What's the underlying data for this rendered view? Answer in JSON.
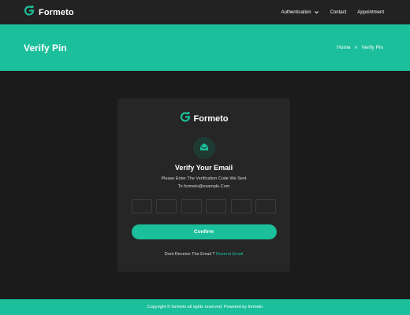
{
  "colors": {
    "accent": "#1bbf9b",
    "navbar_bg": "#222222",
    "page_bg": "#1b1b1b",
    "card_bg": "#262626"
  },
  "navbar": {
    "brand": "Formeto",
    "brand_icon": "formeto-logo-icon",
    "links": [
      {
        "label": "Authentication",
        "has_dropdown": true
      },
      {
        "label": "Contact"
      },
      {
        "label": "Appointment"
      }
    ]
  },
  "hero": {
    "title": "Verify Pin",
    "breadcrumb": {
      "home": "Home",
      "current": "Verify Pin",
      "separator": "»"
    }
  },
  "card": {
    "brand": "Formeto",
    "icon": "envelope-icon",
    "title": "Verify Your Email",
    "subtitle_line1": "Please Enter The Verification Code We Sent",
    "subtitle_line2": "To formeto@example.Com",
    "pin_fields": [
      "",
      "",
      "",
      "",
      "",
      ""
    ],
    "confirm_label": "Confirm",
    "resend_prompt": "Dont Receive The Email ?",
    "resend_link": "Resend Email"
  },
  "footer": {
    "text": "Copyright © formeto all rights reserved. Powered by formeto"
  }
}
